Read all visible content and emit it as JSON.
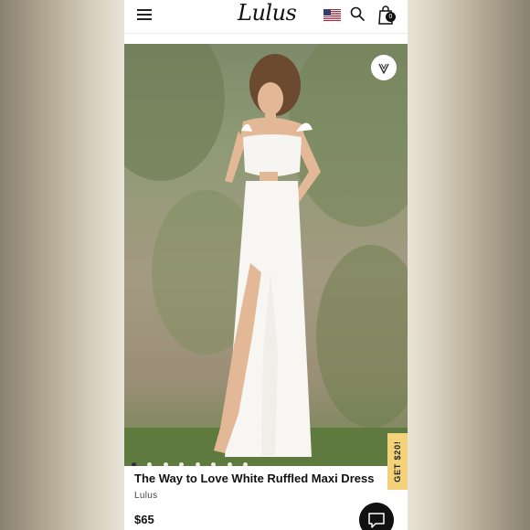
{
  "header": {
    "logo_text": "Lulus",
    "menu_icon": "hamburger-icon",
    "flag_icon": "us-flag-icon",
    "search_icon": "search-icon",
    "bag_icon": "shopping-bag-icon",
    "bag_count": "0"
  },
  "product": {
    "favorite_icon": "heart-icon",
    "image_count": 8,
    "active_image": 1,
    "promo_label": "GET $20!",
    "title": "The Way to Love White Ruffled Maxi Dress",
    "brand": "Lulus",
    "price": "$65"
  },
  "chat_icon": "chat-bubble-icon",
  "colors": {
    "promo_bg": "#f3d27a",
    "text_dark": "#111111",
    "page_bg": "#ffffff"
  }
}
